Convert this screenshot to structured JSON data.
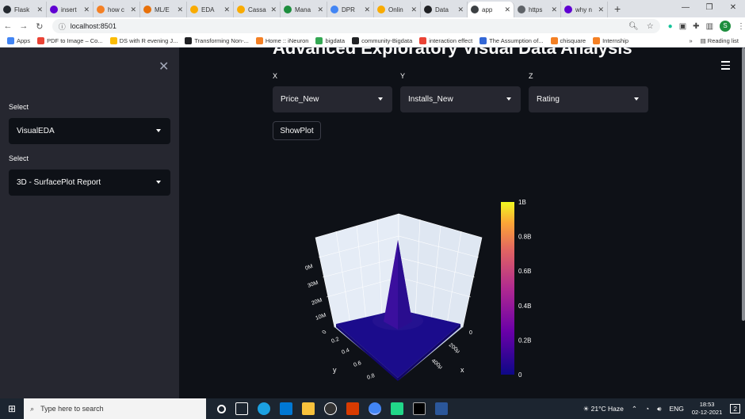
{
  "browser": {
    "tabs": [
      {
        "title": "Flask",
        "color": "#24292f"
      },
      {
        "title": "insert",
        "color": "#6001d2"
      },
      {
        "title": "how c",
        "color": "#f48024"
      },
      {
        "title": "ML/E",
        "color": "#e8710a"
      },
      {
        "title": "EDA",
        "color": "#f9ab00"
      },
      {
        "title": "Cassa",
        "color": "#f9ab00"
      },
      {
        "title": "Mana",
        "color": "#1e8e3e"
      },
      {
        "title": "DPR",
        "color": "#4285f4"
      },
      {
        "title": "Onlin",
        "color": "#f9ab00"
      },
      {
        "title": "Data",
        "color": "#202124"
      },
      {
        "title": "app",
        "color": "#3c4043",
        "active": true
      },
      {
        "title": "https",
        "color": "#5f6368"
      },
      {
        "title": "why n",
        "color": "#6001d2"
      }
    ],
    "url": "localhost:8501",
    "profile_initial": "S",
    "bookmarks": [
      {
        "label": "Apps",
        "color": "#4285f4"
      },
      {
        "label": "PDF to Image – Co...",
        "color": "#ea4335"
      },
      {
        "label": "DS with R evening J...",
        "color": "#fbbc04"
      },
      {
        "label": "Transforming Non-...",
        "color": "#202124"
      },
      {
        "label": "Home :: iNeuron",
        "color": "#f48024"
      },
      {
        "label": "bigdata",
        "color": "#34a853"
      },
      {
        "label": "community-Bigdata",
        "color": "#202124"
      },
      {
        "label": "interaction effect",
        "color": "#ea4335"
      },
      {
        "label": "The Assumption of...",
        "color": "#3367d6"
      },
      {
        "label": "chisquare",
        "color": "#f48024"
      },
      {
        "label": "Internship",
        "color": "#f48024"
      }
    ],
    "more_bookmarks": "»",
    "reading_list": "Reading list"
  },
  "sidebar": {
    "label1": "Select",
    "select1_value": "VisualEDA",
    "label2": "Select",
    "select2_value": "3D - SurfacePlot Report"
  },
  "main": {
    "title": "Advanced Exploratory Visual Data Analysis",
    "x_label": "X",
    "x_value": "Price_New",
    "y_label": "Y",
    "y_value": "Installs_New",
    "z_label": "Z",
    "z_value": "Rating",
    "show_button": "ShowPlot"
  },
  "plot": {
    "colorbar_ticks": [
      "1B",
      "0.8B",
      "0.6B",
      "0.4B",
      "0.2B",
      "0"
    ],
    "z_ticks": [
      "10M",
      "20M",
      "30M",
      "0M"
    ],
    "z_axis_zero": "0",
    "y_ticks": [
      "0",
      "0.2",
      "0.4",
      "0.6",
      "0.8"
    ],
    "y_axis_label": "y",
    "x_ticks": [
      "0",
      "200μ",
      "400μ"
    ],
    "x_axis_label": "x",
    "colors": {
      "surface": "#1b0c8c",
      "peak": "#3b0f9e",
      "scene": "#e5ecf6"
    }
  },
  "taskbar": {
    "search_placeholder": "Type here to search",
    "weather": "21°C Haze",
    "lang": "ENG",
    "time": "18:53",
    "date": "02-12-2021",
    "notification_count": "2"
  }
}
